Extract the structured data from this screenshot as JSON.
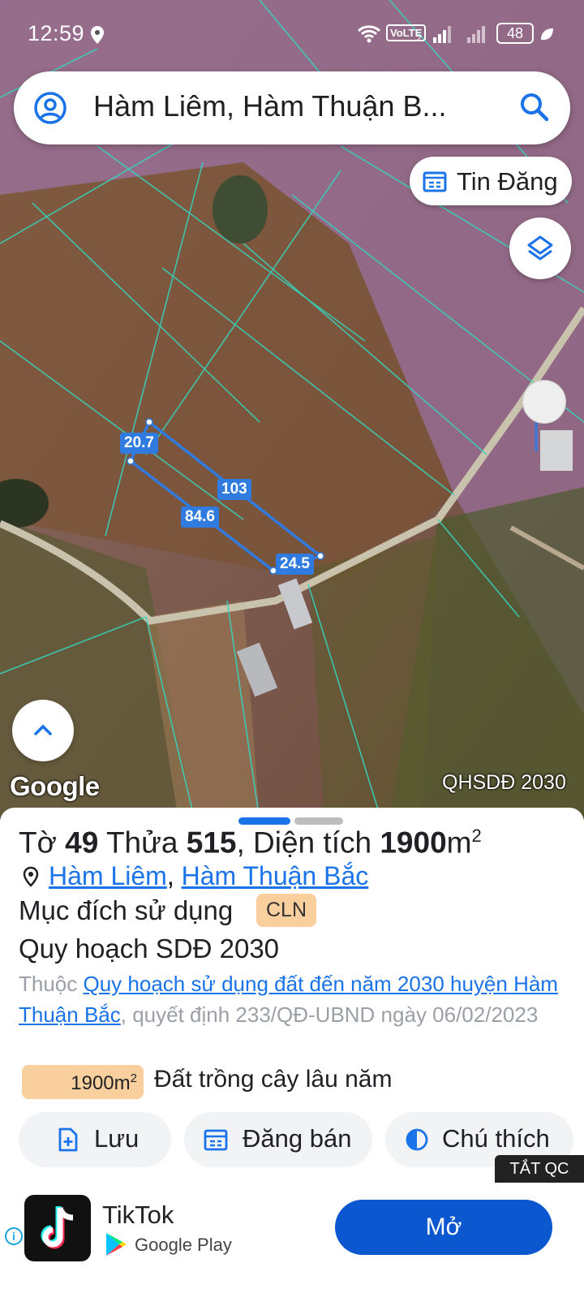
{
  "status_bar": {
    "time": "12:59",
    "network": "VoLTE",
    "sim_slot": "2",
    "battery": "48"
  },
  "search": {
    "query": "Hàm Liêm, Hàm Thuận B..."
  },
  "map": {
    "listing_chip_label": "Tin Đăng",
    "attribution": "Google",
    "layer_code": "QHSDĐ 2030",
    "dimensions": [
      "20.7",
      "103",
      "84.6",
      "24.5"
    ]
  },
  "sheet": {
    "title": {
      "sheet_label": "Tờ",
      "sheet_no": "49",
      "parcel_label": "Thửa",
      "parcel_no": "515",
      "area_label": ", Diện tích",
      "area_value": "1900",
      "area_unit": "m",
      "area_sup": "2"
    },
    "location": {
      "commune": "Hàm Liêm",
      "separator": ",",
      "district": "Hàm Thuận Bắc"
    },
    "purpose_label": "Mục đích sử dụng",
    "purpose_code": "CLN",
    "plan_title": "Quy hoạch SDĐ 2030",
    "plan_desc": {
      "prefix": "Thuộc ",
      "link": "Quy hoạch sử dụng đất đến năm 2030 huyện Hàm Thuận Bắc",
      "suffix": ", quyết định 233/QĐ-UBND ngày 06/02/2023"
    },
    "area_badge": {
      "value": "1900m",
      "sup": "2"
    },
    "land_type": "Đất trồng cây lâu năm",
    "actions": {
      "save": "Lưu",
      "sell": "Đăng bán",
      "legend": "Chú thích"
    }
  },
  "ad": {
    "close_label": "TẮT QC",
    "app_name": "TikTok",
    "store": "Google Play",
    "open_label": "Mở",
    "info": "i"
  },
  "colors": {
    "accent": "#1a73e8",
    "badge": "#f9cf9e",
    "open_button": "#0b57d0"
  }
}
